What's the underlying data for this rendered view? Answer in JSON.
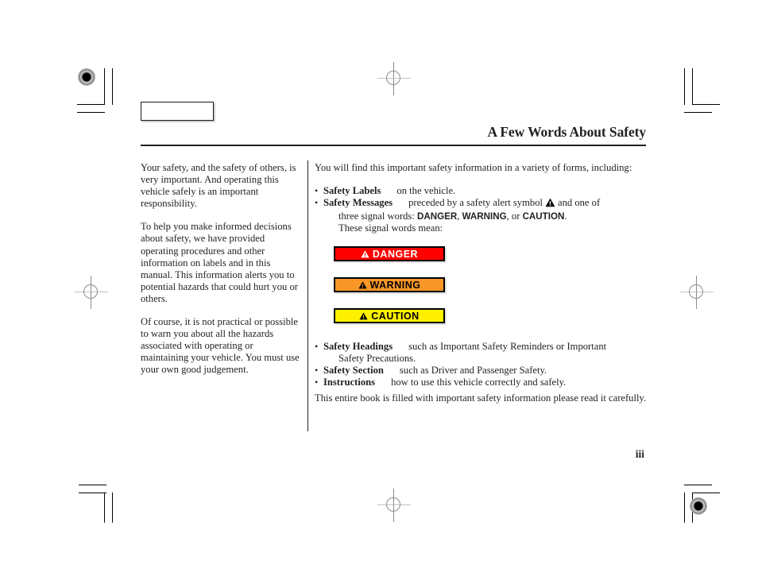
{
  "document": {
    "page_title": "A Few Words About Safety",
    "page_number": "iii"
  },
  "left_column": {
    "paragraphs": [
      "Your safety, and the safety of others, is very important. And operating this vehicle safely is an important responsibility.",
      "To help you make informed decisions about safety, we have provided operating procedures and other information on labels and in this manual. This information alerts you to potential hazards that could hurt you or others.",
      "Of course, it is not practical or possible to warn you about all the hazards associated with operating or maintaining your vehicle. You must use your own good judgement."
    ]
  },
  "right_column": {
    "intro": "You will find this important safety information in a variety of forms, including:",
    "bullets_upper": [
      {
        "term": "Safety Labels",
        "description": "on the vehicle."
      },
      {
        "term": "Safety Messages",
        "description": "preceded by a safety alert symbol",
        "description_after_symbol": "and one of",
        "continuation_prefix": "three signal words:",
        "signal_words": [
          "DANGER",
          "WARNING",
          "CAUTION"
        ],
        "continuation_separator_1": ",",
        "continuation_separator_2": ", or",
        "continuation_suffix": ".",
        "continuation_line_2": "These signal words mean:"
      }
    ],
    "signal_boxes": [
      {
        "label": "DANGER",
        "background": "#ff0000",
        "text_color": "#ffffff",
        "icon": "alert-triangle-icon"
      },
      {
        "label": "WARNING",
        "background": "#f89728",
        "text_color": "#000000",
        "icon": "alert-triangle-icon"
      },
      {
        "label": "CAUTION",
        "background": "#fff000",
        "text_color": "#000000",
        "icon": "alert-triangle-icon"
      }
    ],
    "bullets_lower": [
      {
        "term": "Safety Headings",
        "description": "such as Important Safety Reminders or Important",
        "continuation": "Safety Precautions."
      },
      {
        "term": "Safety Section",
        "description": "such as Driver and Passenger Safety.",
        "continuation": ""
      },
      {
        "term": "Instructions",
        "description": "how to use this vehicle correctly and safely.",
        "continuation": ""
      }
    ],
    "closing": "This entire book is filled with important safety information     please read it carefully."
  }
}
